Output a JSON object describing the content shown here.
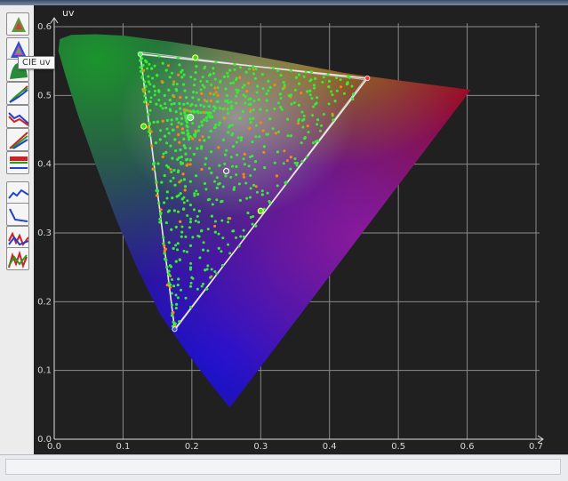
{
  "tooltip": "CIE uv",
  "toolbar": [
    {
      "name": "color-triangle-tool",
      "icon": "triangle-gamut-icon"
    },
    {
      "name": "cie-uv-tool",
      "icon": "cie-uv-icon"
    },
    {
      "name": "cie-xy-tool",
      "icon": "cie-xy-icon"
    },
    {
      "name": "rgb-curve-tool",
      "icon": "rgb-curve-icon"
    },
    {
      "name": "gamma-curve-tool",
      "icon": "gamma-curve-icon"
    },
    {
      "name": "color-levels-tool",
      "icon": "color-levels-icon"
    },
    {
      "name": "luminance-tool",
      "icon": "luminance-icon"
    },
    {
      "name": "deltae-tool",
      "icon": "deltae-icon"
    },
    {
      "name": "grayscale-tool",
      "icon": "grayscale-icon"
    },
    {
      "name": "color-comparator-tool",
      "icon": "comparator-icon"
    },
    {
      "name": "saturation-sweep-tool",
      "icon": "saturation-sweep-icon"
    }
  ],
  "chart_data": {
    "type": "scatter",
    "title": "",
    "xlabel": "",
    "ylabel": "uv",
    "xlim": [
      0.0,
      0.7
    ],
    "ylim": [
      0.0,
      0.6
    ],
    "xticks": [
      "0.0",
      "0.1",
      "0.2",
      "0.3",
      "0.4",
      "0.5",
      "0.6",
      "0.7"
    ],
    "yticks": [
      "0.0",
      "0.1",
      "0.2",
      "0.3",
      "0.4",
      "0.5",
      "0.6"
    ],
    "grid": true,
    "colors": {
      "background": "#202020",
      "grid": "#8a8a8a",
      "gamut_outline": "#e8e8e8",
      "measured_points": "#33ee33",
      "reference_points": "#ff8800"
    },
    "spectral_locus": [
      [
        0.255,
        0.046
      ],
      [
        0.22,
        0.09
      ],
      [
        0.19,
        0.13
      ],
      [
        0.155,
        0.18
      ],
      [
        0.12,
        0.25
      ],
      [
        0.09,
        0.32
      ],
      [
        0.06,
        0.4
      ],
      [
        0.035,
        0.47
      ],
      [
        0.016,
        0.53
      ],
      [
        0.006,
        0.565
      ],
      [
        0.008,
        0.582
      ],
      [
        0.025,
        0.588
      ],
      [
        0.06,
        0.589
      ],
      [
        0.1,
        0.587
      ],
      [
        0.17,
        0.578
      ],
      [
        0.25,
        0.565
      ],
      [
        0.33,
        0.55
      ],
      [
        0.42,
        0.533
      ],
      [
        0.5,
        0.522
      ],
      [
        0.56,
        0.514
      ],
      [
        0.605,
        0.508
      ]
    ],
    "gamut_target": {
      "red": [
        0.451,
        0.523
      ],
      "green": [
        0.125,
        0.563
      ],
      "blue": [
        0.175,
        0.158
      ]
    },
    "gamut_measured": {
      "red": [
        0.455,
        0.525
      ],
      "green": [
        0.125,
        0.56
      ],
      "blue": [
        0.175,
        0.16
      ]
    },
    "white_point": [
      0.198,
      0.468
    ],
    "key_points": [
      {
        "u": 0.205,
        "v": 0.555
      },
      {
        "u": 0.13,
        "v": 0.455
      },
      {
        "u": 0.25,
        "v": 0.39
      },
      {
        "u": 0.3,
        "v": 0.332
      }
    ]
  }
}
